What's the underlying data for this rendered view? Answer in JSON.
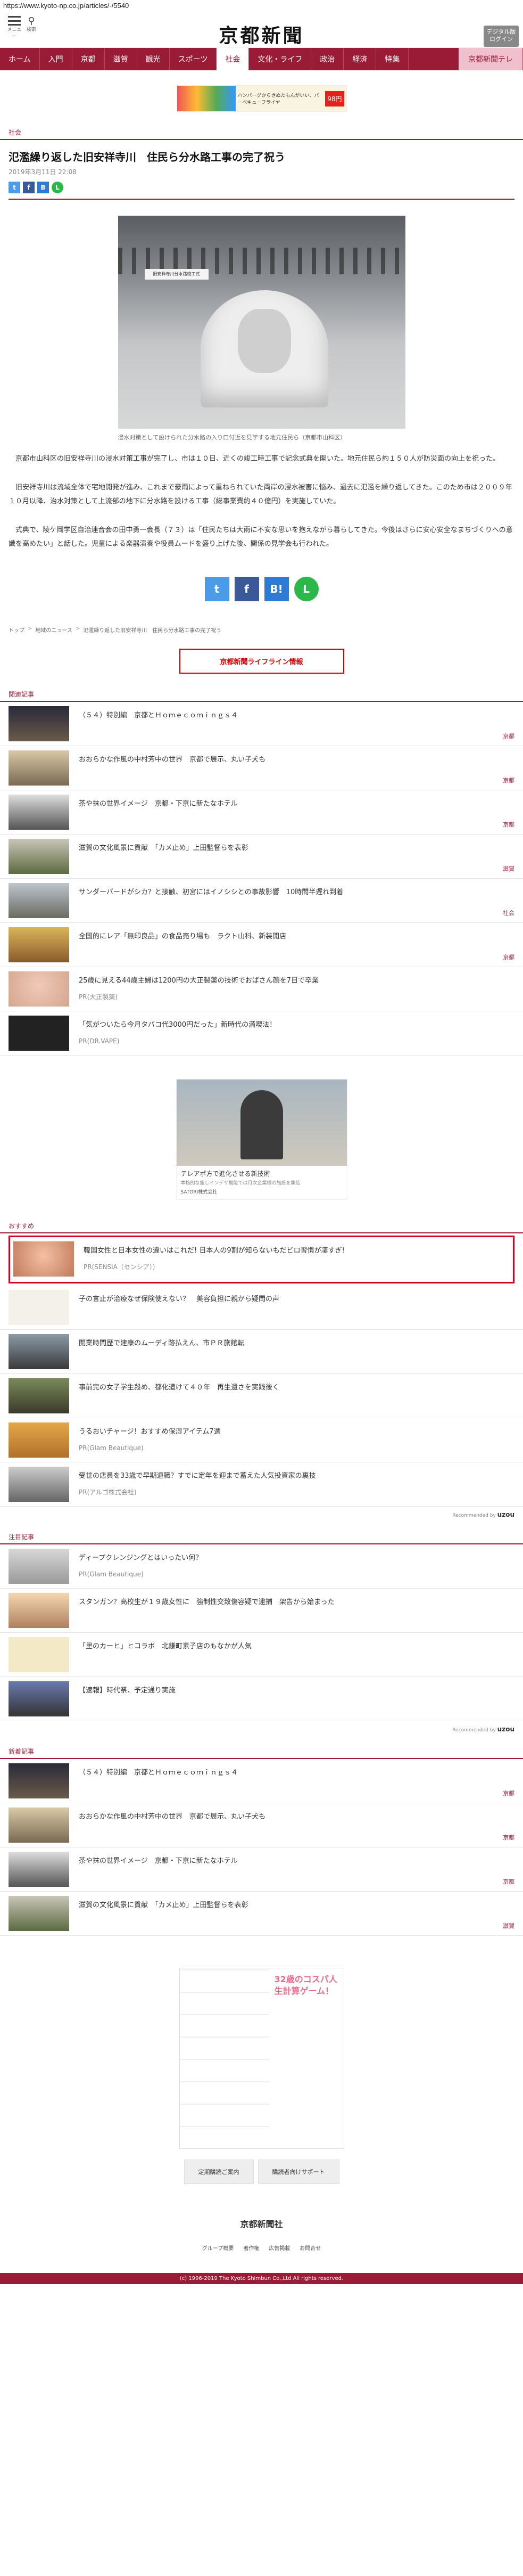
{
  "url": "https://www.kyoto-np.co.jp/articles/-/5540",
  "header": {
    "menu_label": "メニュー",
    "search_label": "検索",
    "logo": "京都新聞",
    "digital_btn": "デジタル版\nログイン"
  },
  "nav": [
    "ホーム",
    "入門",
    "京都",
    "滋賀",
    "観光",
    "スポーツ",
    "社会",
    "文化・ライフ",
    "政治",
    "経済",
    "特集",
    "京都新聞テレ"
  ],
  "nav_active_index": 6,
  "ad_top": {
    "text": "ハンバーグからきぬたもんがいい、バーベキューフライヤ",
    "price": "98円"
  },
  "article": {
    "section": "社会",
    "title": "氾濫繰り返した旧安祥寺川　住民ら分水路工事の完了祝う",
    "date": "2019年3月11日 22:08",
    "photo_banner": "旧安祥寺川分水路竣工式",
    "caption": "浸水対策として設けられた分水路の入り口付近を見学する地元住民ら（京都市山科区）",
    "paragraphs": [
      "京都市山科区の旧安祥寺川の浸水対策工事が完了し、市は１０日、近くの竣工時工事で記念式典を開いた。地元住民ら約１５０人が防災面の向上を祝った。",
      "旧安祥寺川は流域全体で宅地開発が進み、これまで豪雨によって重ねられていた両岸の浸水被害に悩み、過去に氾濫を繰り返してきた。このため市は２００９年１０月以降、治水対策として上流部の地下に分水路を設ける工事（総事業費約４０億円）を実施していた。",
      "式典で、陵ケ岡学区自治連合会の田中勇一会長（７３）は「住民たちは大雨に不安な思いを抱えながら暮らしてきた。今後はさらに安心安全なまちづくりへの意識を高めたい」と話した。児童による楽器演奏や役員ムードを盛り上げた後、関係の見学会も行われた。"
    ]
  },
  "breadcrumb": [
    "トップ",
    "地域のニュース",
    "氾濫繰り返した旧安祥寺川　住民ら分水路工事の完了祝う"
  ],
  "lifeline_btn": "京都新聞ライフライン情報",
  "related": {
    "heading": "関連記事",
    "items": [
      {
        "title": "（５４）特別編　京都とＨｏｍｅｃｏｍｉｎｇｓ４",
        "cat": "京都"
      },
      {
        "title": "おおらかな作風の中村芳中の世界　京都で展示、丸い子犬も",
        "cat": "京都"
      },
      {
        "title": "茶や抹の世界イメージ　京都・下京に新たなホテル",
        "cat": "京都"
      },
      {
        "title": "滋賀の文化風景に貢献　「カメ止め」上田監督らを表彰",
        "cat": "滋賀"
      },
      {
        "title": "サンダーバードがシカ？と接触、初宮にはイノシシとの事故影響　10時間半遅れ到着",
        "cat": "社会"
      },
      {
        "title": "全国的にレア「無印良品」の食品売り場も　ラクト山科、新装開店",
        "cat": "京都"
      },
      {
        "title": "25歳に見える44歳主婦は1200円の大正製薬の技術でおばさん顔を7日で卒業",
        "pr": "PR(大正製薬)"
      },
      {
        "title": "「気がついたら今月タバコ代3000円だった」新時代の満喫法！",
        "pr": "PR(DR.VAPE)"
      }
    ]
  },
  "ad_mid": {
    "title": "テレアポ方で進化させる新技術",
    "sub": "本格的な施しインデザ機能では月次企業様の施設を集結",
    "company": "SATORI株式会社"
  },
  "recommended": {
    "heading": "おすすめ",
    "highlight": {
      "title": "韓国女性と日本女性の違いはこれだ! 日本人の9割が知らないもだビロ習慣が凄すぎ!",
      "pr": "PR(SENSIA（センシア）)"
    },
    "items": [
      {
        "title": "子の言止が治療なぜ保険使えない？　美容負担に親から疑問の声",
        "cat": ""
      },
      {
        "title": "開業時間歴で建康のムーディ跡払えん、市ＰＲ旅館転",
        "cat": ""
      },
      {
        "title": "事前完の女子学生殺め、都化遭けて４０年　再生遺さを実践後く",
        "cat": ""
      },
      {
        "title": "うるおいチャージ！おすすめ保湿アイテム7選",
        "pr": "PR(Glam Beautique)"
      },
      {
        "title": "受世の店員を33歳で早期退職？すでに定年を迎まで蓄えた人気投資家の裏技",
        "pr": "PR(アルゴ株式会社)"
      }
    ],
    "by": "Recommended by",
    "by_brand": "uzou"
  },
  "notable": {
    "heading": "注目記事",
    "items": [
      {
        "title": "ディープクレンジングとはいったい何？",
        "pr": "PR(Glam Beautique)"
      },
      {
        "title": "スタンガン？高校生が１９歳女性に　強制性交致傷容疑で逮捕　架告から始まった",
        "cat": ""
      },
      {
        "title": "「里のカーヒ」ヒコラボ　北鎌町素子店のもなかが人気",
        "cat": ""
      },
      {
        "title": "【速報】時代祭、予定通り実施",
        "cat": ""
      }
    ],
    "by": "Recommended by",
    "by_brand": "uzou"
  },
  "latest": {
    "heading": "新着記事",
    "items": [
      {
        "title": "（５４）特別編　京都とＨｏｍｅｃｏｍｉｎｇｓ４",
        "cat": "京都"
      },
      {
        "title": "おおらかな作風の中村芳中の世界　京都で展示、丸い子犬も",
        "cat": "京都"
      },
      {
        "title": "茶や抹の世界イメージ　京都・下京に新たなホテル",
        "cat": "京都"
      },
      {
        "title": "滋賀の文化風景に貢献　「カメ止め」上田監督らを表彰",
        "cat": "滋賀"
      }
    ]
  },
  "manga_ad": "32歳のコスパ人生計算ゲーム！",
  "footer": {
    "btns": [
      "定期購読ご案内",
      "購読者向けサポート"
    ],
    "logo": "京都新聞社",
    "links": [
      "グループ概要",
      "著作権",
      "広告掲載",
      "お問合せ"
    ],
    "copyright": "(c) 1996-2019 The Kyoto Shimbun Co.,Ltd All rights reserved."
  },
  "colors": {
    "brand": "#9a1b35",
    "highlight": "#d0021b"
  }
}
